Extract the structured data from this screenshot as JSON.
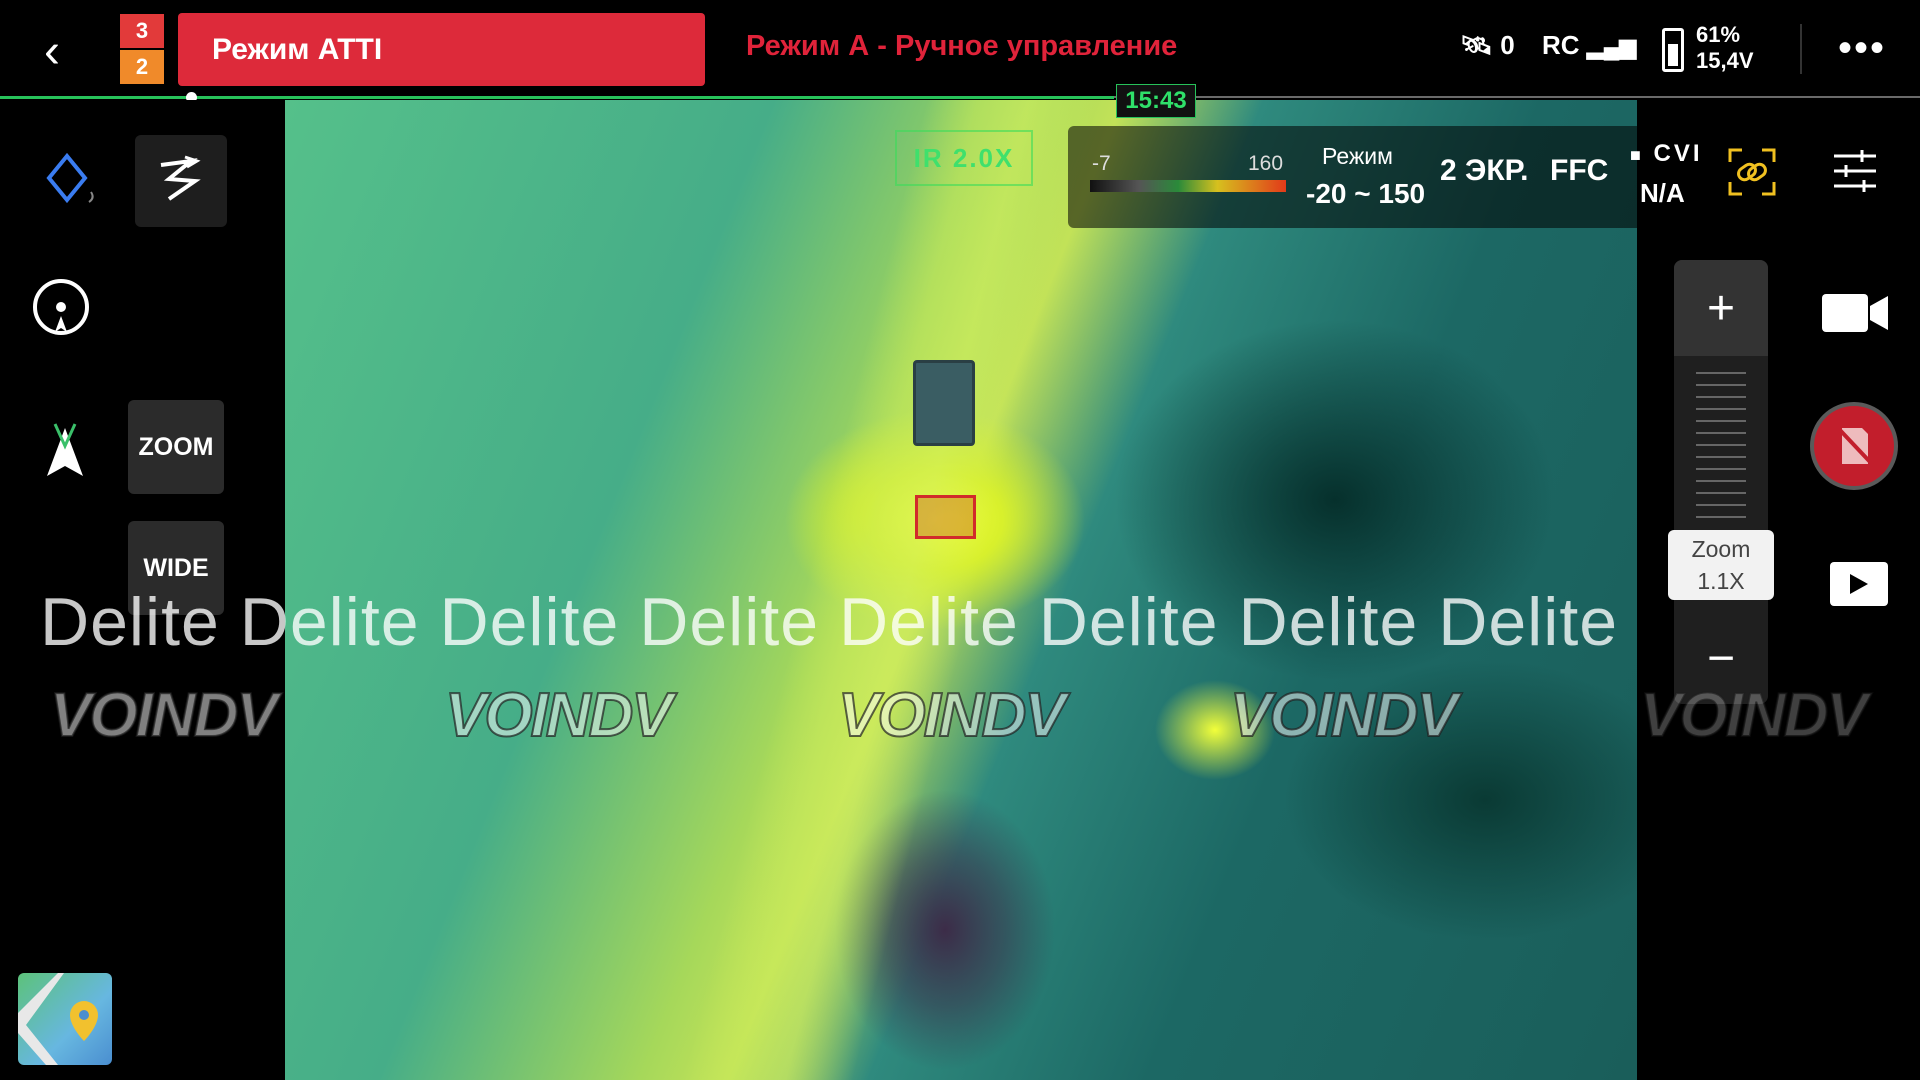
{
  "topbar": {
    "badge_top": "3",
    "badge_bottom": "2",
    "mode_button": "Режим ATTI",
    "mode_status": "Режим А - Ручное управление",
    "gps_count": "0",
    "rc_label": "RC",
    "battery_percent": "61%",
    "battery_voltage": "15,4V",
    "flight_time": "15:43",
    "progress_fraction": 0.58
  },
  "left_panel": {
    "zoom_tile": "ZOOM",
    "wide_tile": "WIDE"
  },
  "camera_hud": {
    "ir_zoom": "IR 2.0X",
    "scale_min": "-7",
    "scale_max": "160",
    "mode_label": "Режим",
    "mode_range": "-20 ~ 150",
    "screens": "2 ЭКР.",
    "ffc": "FFC",
    "cvi": "CVI",
    "cvi_value": "N/A"
  },
  "right_panel": {
    "zoom_plus": "+",
    "zoom_minus": "−",
    "zoom_label": "Zoom",
    "zoom_value": "1.1X"
  },
  "watermarks": {
    "text": "Delite Delite Delite Delite Delite Delite Delite Delite",
    "logos": [
      "VOINDV",
      "VOINDV",
      "VOINDV",
      "VOINDV",
      "VOINDV"
    ]
  },
  "icons": {
    "back": "chevron-left-icon",
    "gps": "satellite-icon",
    "more": "more-icon"
  },
  "colors": {
    "mode_button_bg": "#dd2a3a",
    "mode_status": "#e0233a",
    "progress": "#27c25a",
    "record": "#c21e2c"
  }
}
